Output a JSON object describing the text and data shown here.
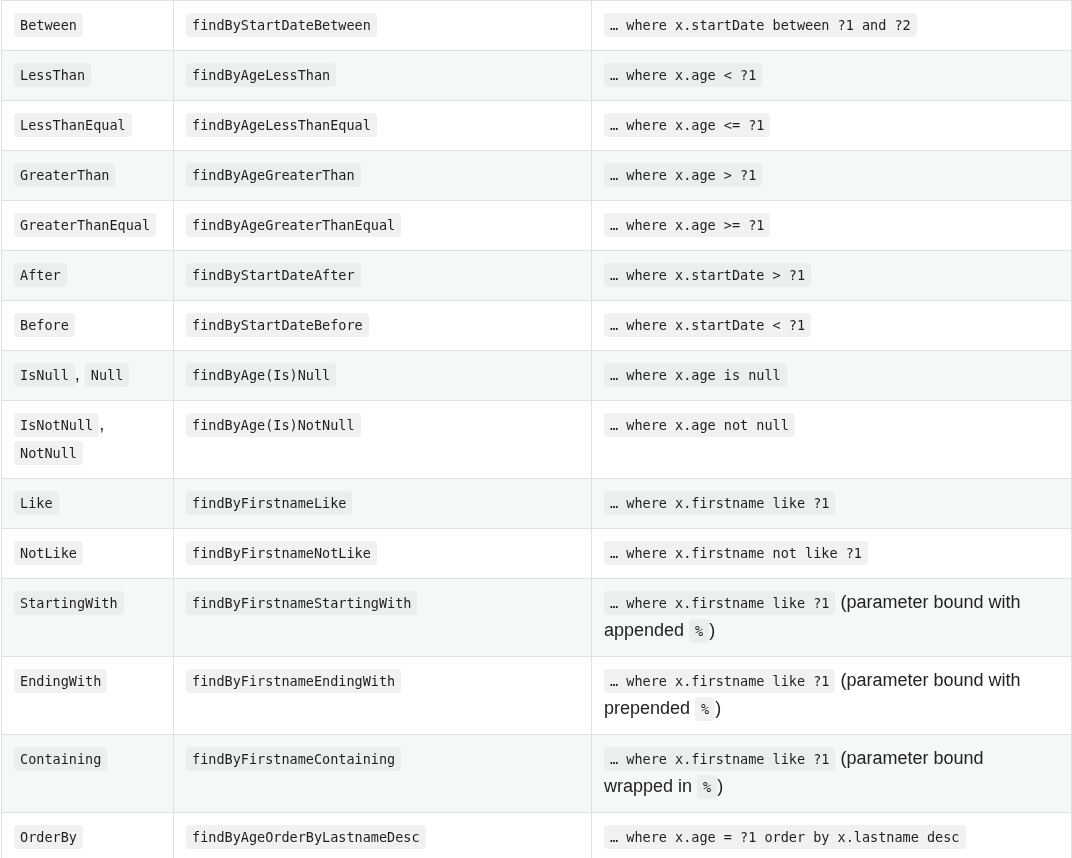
{
  "table": {
    "rows": [
      {
        "keyword": [
          {
            "kind": "code",
            "text": "Between"
          }
        ],
        "sample": [
          {
            "kind": "code",
            "text": "findByStartDateBetween"
          }
        ],
        "jpql": [
          {
            "kind": "code",
            "text": "… where x.startDate between ?1 and ?2"
          }
        ]
      },
      {
        "keyword": [
          {
            "kind": "code",
            "text": "LessThan"
          }
        ],
        "sample": [
          {
            "kind": "code",
            "text": "findByAgeLessThan"
          }
        ],
        "jpql": [
          {
            "kind": "code",
            "text": "… where x.age < ?1"
          }
        ]
      },
      {
        "keyword": [
          {
            "kind": "code",
            "text": "LessThanEqual"
          }
        ],
        "sample": [
          {
            "kind": "code",
            "text": "findByAgeLessThanEqual"
          }
        ],
        "jpql": [
          {
            "kind": "code",
            "text": "… where x.age <= ?1"
          }
        ]
      },
      {
        "keyword": [
          {
            "kind": "code",
            "text": "GreaterThan"
          }
        ],
        "sample": [
          {
            "kind": "code",
            "text": "findByAgeGreaterThan"
          }
        ],
        "jpql": [
          {
            "kind": "code",
            "text": "… where x.age > ?1"
          }
        ]
      },
      {
        "keyword": [
          {
            "kind": "code",
            "text": "GreaterThanEqual"
          }
        ],
        "sample": [
          {
            "kind": "code",
            "text": "findByAgeGreaterThanEqual"
          }
        ],
        "jpql": [
          {
            "kind": "code",
            "text": "… where x.age >= ?1"
          }
        ]
      },
      {
        "keyword": [
          {
            "kind": "code",
            "text": "After"
          }
        ],
        "sample": [
          {
            "kind": "code",
            "text": "findByStartDateAfter"
          }
        ],
        "jpql": [
          {
            "kind": "code",
            "text": "… where x.startDate > ?1"
          }
        ]
      },
      {
        "keyword": [
          {
            "kind": "code",
            "text": "Before"
          }
        ],
        "sample": [
          {
            "kind": "code",
            "text": "findByStartDateBefore"
          }
        ],
        "jpql": [
          {
            "kind": "code",
            "text": "… where x.startDate < ?1"
          }
        ]
      },
      {
        "keyword": [
          {
            "kind": "code",
            "text": "IsNull"
          },
          {
            "kind": "text",
            "text": ","
          },
          {
            "kind": "code",
            "text": "Null"
          }
        ],
        "sample": [
          {
            "kind": "code",
            "text": "findByAge(Is)Null"
          }
        ],
        "jpql": [
          {
            "kind": "code",
            "text": "… where x.age is null"
          }
        ]
      },
      {
        "keyword": [
          {
            "kind": "code",
            "text": "IsNotNull"
          },
          {
            "kind": "text",
            "text": ","
          },
          {
            "kind": "code",
            "text": "NotNull"
          }
        ],
        "sample": [
          {
            "kind": "code",
            "text": "findByAge(Is)NotNull"
          }
        ],
        "jpql": [
          {
            "kind": "code",
            "text": "… where x.age not null"
          }
        ]
      },
      {
        "keyword": [
          {
            "kind": "code",
            "text": "Like"
          }
        ],
        "sample": [
          {
            "kind": "code",
            "text": "findByFirstnameLike"
          }
        ],
        "jpql": [
          {
            "kind": "code",
            "text": "… where x.firstname like ?1"
          }
        ]
      },
      {
        "keyword": [
          {
            "kind": "code",
            "text": "NotLike"
          }
        ],
        "sample": [
          {
            "kind": "code",
            "text": "findByFirstnameNotLike"
          }
        ],
        "jpql": [
          {
            "kind": "code",
            "text": "… where x.firstname not like ?1"
          }
        ]
      },
      {
        "keyword": [
          {
            "kind": "code",
            "text": "StartingWith"
          }
        ],
        "sample": [
          {
            "kind": "code",
            "text": "findByFirstnameStartingWith"
          }
        ],
        "jpql": [
          {
            "kind": "code",
            "text": "… where x.firstname like ?1"
          },
          {
            "kind": "text",
            "text": "(parameter bound with"
          },
          {
            "kind": "text",
            "text": "appended"
          },
          {
            "kind": "code",
            "text": "%"
          },
          {
            "kind": "text",
            "text": ")"
          }
        ]
      },
      {
        "keyword": [
          {
            "kind": "code",
            "text": "EndingWith"
          }
        ],
        "sample": [
          {
            "kind": "code",
            "text": "findByFirstnameEndingWith"
          }
        ],
        "jpql": [
          {
            "kind": "code",
            "text": "… where x.firstname like ?1"
          },
          {
            "kind": "text",
            "text": "(parameter bound with"
          },
          {
            "kind": "text",
            "text": "prepended"
          },
          {
            "kind": "code",
            "text": "%"
          },
          {
            "kind": "text",
            "text": ")"
          }
        ]
      },
      {
        "keyword": [
          {
            "kind": "code",
            "text": "Containing"
          }
        ],
        "sample": [
          {
            "kind": "code",
            "text": "findByFirstnameContaining"
          }
        ],
        "jpql": [
          {
            "kind": "code",
            "text": "… where x.firstname like ?1"
          },
          {
            "kind": "text",
            "text": "(parameter bound"
          },
          {
            "kind": "text",
            "text": "wrapped in"
          },
          {
            "kind": "code",
            "text": "%"
          },
          {
            "kind": "text",
            "text": ")"
          }
        ]
      },
      {
        "keyword": [
          {
            "kind": "code",
            "text": "OrderBy"
          }
        ],
        "sample": [
          {
            "kind": "code",
            "text": "findByAgeOrderByLastnameDesc"
          }
        ],
        "jpql": [
          {
            "kind": "code",
            "text": "… where x.age = ?1 order by x.lastname desc"
          }
        ]
      }
    ]
  }
}
